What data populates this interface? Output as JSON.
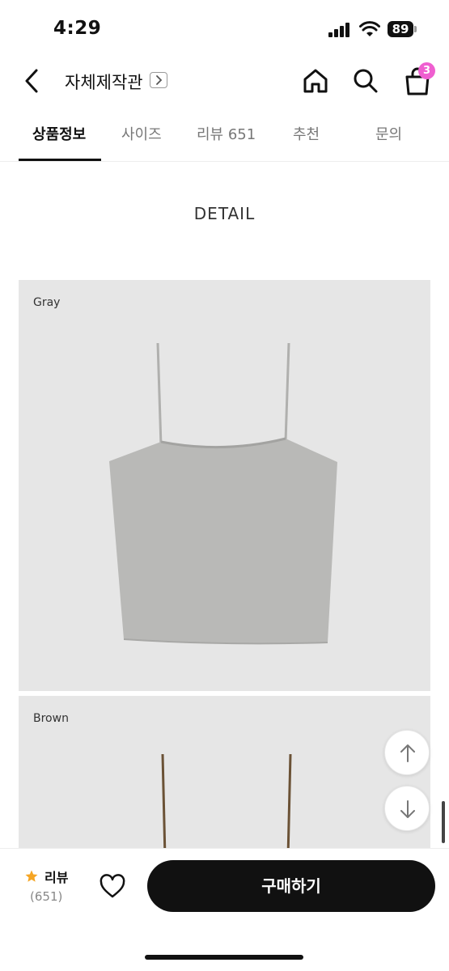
{
  "status_bar": {
    "time": "4:29",
    "battery": "89",
    "icons": [
      "signal-icon",
      "wifi-icon",
      "battery-icon"
    ]
  },
  "header": {
    "store_name": "자체제작관",
    "cart_count": "3",
    "icons": [
      "back-arrow-icon",
      "chevron-right-icon",
      "home-icon",
      "search-icon",
      "shopping-bag-icon"
    ]
  },
  "tabs": [
    {
      "label": "상품정보",
      "active": true
    },
    {
      "label": "사이즈",
      "active": false
    },
    {
      "label": "리뷰 651",
      "active": false
    },
    {
      "label": "추천",
      "active": false
    },
    {
      "label": "문의",
      "active": false
    }
  ],
  "content": {
    "section_title": "DETAIL",
    "images": [
      {
        "label": "Gray",
        "color": "#b9b9b7"
      },
      {
        "label": "Brown",
        "color": "#6b5236"
      }
    ]
  },
  "scroll_controls": {
    "icons": [
      "arrow-up-icon",
      "arrow-down-icon"
    ]
  },
  "bottom_bar": {
    "review_label": "리뷰",
    "review_count": "(651)",
    "buy_label": "구매하기",
    "star_color": "#f5a524",
    "icons": [
      "star-icon",
      "heart-icon"
    ]
  }
}
